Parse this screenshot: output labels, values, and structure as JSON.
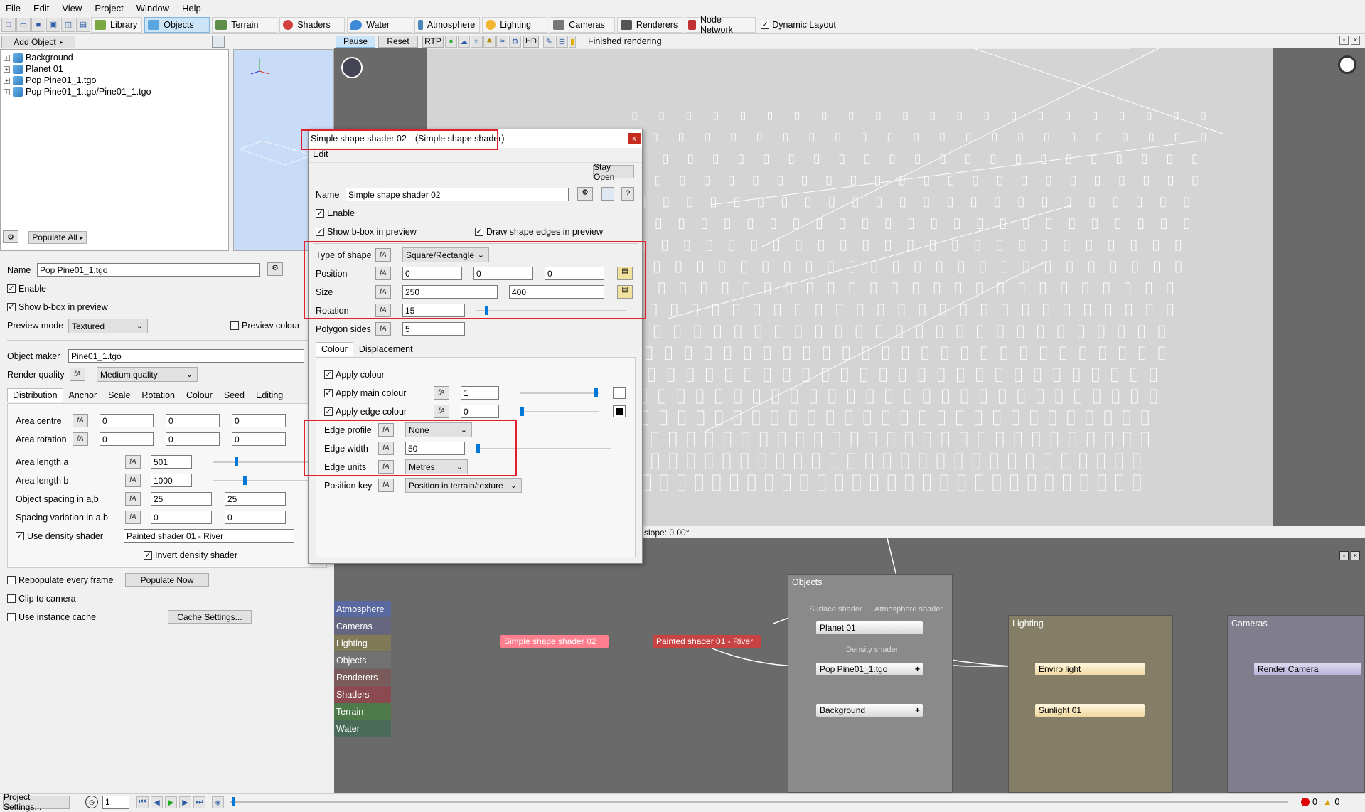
{
  "menu": [
    "File",
    "Edit",
    "View",
    "Project",
    "Window",
    "Help"
  ],
  "toolbar": {
    "buttons": [
      "Library",
      "Objects",
      "Terrain",
      "Shaders",
      "Water",
      "Atmosphere",
      "Lighting",
      "Cameras",
      "Renderers",
      "Node Network"
    ],
    "dynamic_layout": "Dynamic Layout",
    "active": "Objects"
  },
  "left": {
    "add_object": "Add Object",
    "tree": [
      "Background",
      "Planet 01",
      "Pop Pine01_1.tgo",
      "Pop Pine01_1.tgo/Pine01_1.tgo"
    ],
    "populate_all": "Populate All",
    "name_label": "Name",
    "name_value": "Pop Pine01_1.tgo",
    "enable": "Enable",
    "show_bbox": "Show b-box in preview",
    "preview_mode_label": "Preview mode",
    "preview_mode_value": "Textured",
    "preview_colour": "Preview colour",
    "object_maker_label": "Object maker",
    "object_maker_value": "Pine01_1.tgo",
    "render_quality_label": "Render quality",
    "render_quality_value": "Medium quality",
    "tabs": [
      "Distribution",
      "Anchor",
      "Scale",
      "Rotation",
      "Colour",
      "Seed",
      "Editing"
    ],
    "area_centre": "Area centre",
    "area_centre_values": [
      "0",
      "0",
      "0"
    ],
    "area_rotation": "Area rotation",
    "area_rotation_values": [
      "0",
      "0",
      "0"
    ],
    "area_length_a": "Area length a",
    "area_length_a_value": "501",
    "area_length_b": "Area length b",
    "area_length_b_value": "1000",
    "object_spacing": "Object spacing in a,b",
    "object_spacing_values": [
      "25",
      "25"
    ],
    "spacing_variation": "Spacing variation in a,b",
    "spacing_variation_values": [
      "0",
      "0"
    ],
    "use_density_shader": "Use density shader",
    "density_shader_value": "Painted shader 01 - River",
    "invert_density": "Invert density shader",
    "repopulate": "Repopulate every frame",
    "populate_now": "Populate Now",
    "clip_to_camera": "Clip to camera",
    "use_instance_cache": "Use instance cache",
    "cache_settings": "Cache Settings..."
  },
  "viewport": {
    "pause": "Pause",
    "reset": "Reset",
    "rtp": "RTP",
    "hd": "HD",
    "status": "Finished rendering",
    "slope": "slope: 0.00°"
  },
  "dialog": {
    "title": "Simple shape shader 02",
    "subtitle": "(Simple shape shader)",
    "close": "x",
    "edit_menu": "Edit",
    "stay_open": "Stay Open",
    "name_label": "Name",
    "name_value": "Simple shape shader 02",
    "help": "?",
    "enable": "Enable",
    "show_bbox": "Show b-box in preview",
    "draw_edges": "Draw shape edges in preview",
    "type_label": "Type of shape",
    "type_value": "Square/Rectangle",
    "position_label": "Position",
    "position_values": [
      "0",
      "0",
      "0"
    ],
    "size_label": "Size",
    "size_values": [
      "250",
      "400"
    ],
    "rotation_label": "Rotation",
    "rotation_value": "15",
    "polygon_label": "Polygon sides",
    "polygon_value": "5",
    "tabs": [
      "Colour",
      "Displacement"
    ],
    "apply_colour": "Apply colour",
    "apply_main": "Apply main colour",
    "apply_main_value": "1",
    "apply_edge": "Apply edge colour",
    "apply_edge_value": "0",
    "edge_profile_label": "Edge profile",
    "edge_profile_value": "None",
    "edge_width_label": "Edge width",
    "edge_width_value": "50",
    "edge_units_label": "Edge units",
    "edge_units_value": "Metres",
    "position_key_label": "Position key",
    "position_key_value": "Position in terrain/texture"
  },
  "nodes": {
    "categories": [
      "Atmosphere",
      "Cameras",
      "Lighting",
      "Objects",
      "Renderers",
      "Shaders",
      "Terrain",
      "Water"
    ],
    "simple_shape": "Simple shape shader 02",
    "painted": "Painted shader 01 - River",
    "objects_group": "Objects",
    "surface_shader": "Surface shader",
    "atmosphere_shader": "Atmosphere shader",
    "density_shader": "Density shader",
    "planet": "Planet 01",
    "pop_pine": "Pop Pine01_1.tgo",
    "background": "Background",
    "lighting_group": "Lighting",
    "enviro_light": "Enviro light",
    "sunlight": "Sunlight 01",
    "cameras_group": "Cameras",
    "render_camera": "Render Camera"
  },
  "status": {
    "project_settings": "Project Settings...",
    "frame": "1",
    "errors": "0",
    "warnings": "0"
  }
}
